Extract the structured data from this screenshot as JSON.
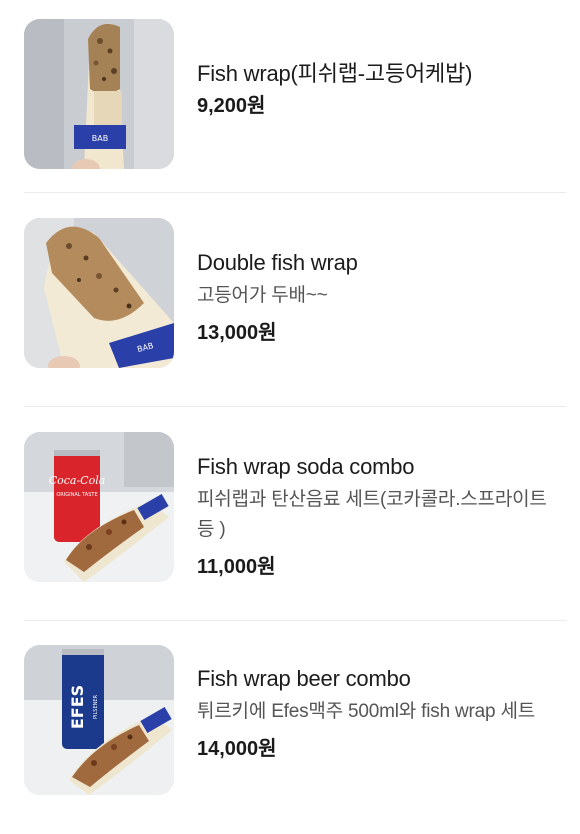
{
  "menu": {
    "items": [
      {
        "name": "Fish wrap(피쉬랩-고등어케밥)",
        "description": "",
        "price": "9,200원",
        "image_icon": "fish-wrap-photo"
      },
      {
        "name": "Double fish wrap",
        "description": "고등어가 두배~~",
        "price": "13,000원",
        "image_icon": "double-fish-wrap-photo"
      },
      {
        "name": "Fish wrap soda combo",
        "description": "피쉬랩과 탄산음료 세트(코카콜라.스프라이트 등 )",
        "price": "11,000원",
        "image_icon": "soda-combo-photo"
      },
      {
        "name": "Fish wrap beer combo",
        "description": "튀르키에 Efes맥주 500ml와 fish wrap 세트",
        "price": "14,000원",
        "image_icon": "beer-combo-photo"
      }
    ],
    "image_text": {
      "wrap_band": "BAB",
      "can_brand": "Coca-Cola",
      "can_sub": "ORIGINAL TASTE",
      "beer_brand": "EFES",
      "beer_sub": "PILSENER"
    }
  },
  "colors": {
    "text_primary": "#1c1c1c",
    "text_secondary": "#555555",
    "divider": "#ececec",
    "wrap_band_blue": "#2a3fa8",
    "coke_red": "#d8242a",
    "efes_blue": "#1c3a8c"
  }
}
